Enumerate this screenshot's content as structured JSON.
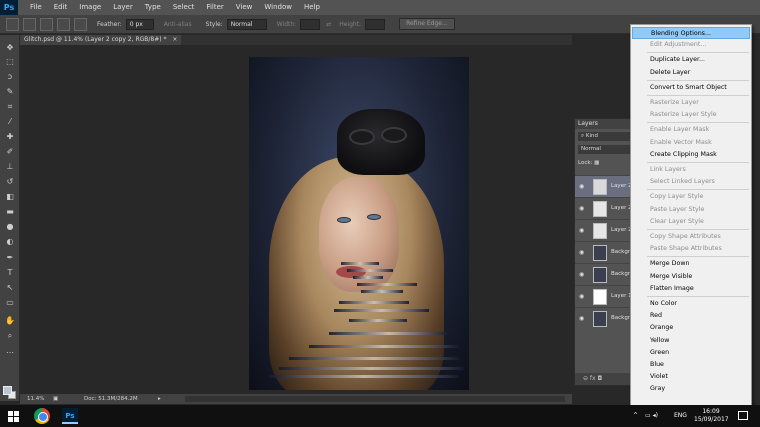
{
  "app": {
    "logo": "Ps"
  },
  "menubar": [
    "File",
    "Edit",
    "Image",
    "Layer",
    "Type",
    "Select",
    "Filter",
    "View",
    "Window",
    "Help"
  ],
  "options_bar": {
    "feather_label": "Feather:",
    "feather_value": "0 px",
    "antialias_label": "Anti-alias",
    "style_label": "Style:",
    "style_value": "Normal",
    "width_label": "Width:",
    "height_label": "Height:",
    "refine_edge": "Refine Edge..."
  },
  "document": {
    "tab_title": "Glitch.psd @ 11.4% (Layer 2 copy 2, RGB/8#) *",
    "tab_close": "×"
  },
  "status": {
    "zoom": "11.4%",
    "doc_info": "Doc: 51.3M/284.2M"
  },
  "layers_panel": {
    "tab": "Layers",
    "kind_filter": "Kind",
    "blend_mode": "Normal",
    "lock_label": "Lock:",
    "footer_icons": "⊖  fx  ◘",
    "layers": [
      {
        "name": "Layer 2 ...",
        "selected": true,
        "thumb": "#d9d9d9"
      },
      {
        "name": "Layer 2 ...",
        "selected": false,
        "thumb": "#e6e6e6"
      },
      {
        "name": "Layer 2 ...",
        "selected": false,
        "thumb": "#e6e6e6"
      },
      {
        "name": "Backgro...",
        "selected": false,
        "thumb": "#3a3f50"
      },
      {
        "name": "Backgro...",
        "selected": false,
        "thumb": "#3a3f50"
      },
      {
        "name": "Layer 1",
        "selected": false,
        "thumb": "#ffffff"
      },
      {
        "name": "Backgro...",
        "selected": false,
        "thumb": "#3a3f50"
      }
    ]
  },
  "context_menu": {
    "items": [
      {
        "label": "Blending Options...",
        "state": "hover"
      },
      {
        "label": "Edit Adjustment...",
        "state": "disabled"
      },
      {
        "sep": true
      },
      {
        "label": "Duplicate Layer...",
        "state": "enabled"
      },
      {
        "label": "Delete Layer",
        "state": "enabled"
      },
      {
        "sep": true
      },
      {
        "label": "Convert to Smart Object",
        "state": "enabled"
      },
      {
        "sep": true
      },
      {
        "label": "Rasterize Layer",
        "state": "disabled"
      },
      {
        "label": "Rasterize Layer Style",
        "state": "disabled"
      },
      {
        "sep": true
      },
      {
        "label": "Enable Layer Mask",
        "state": "disabled"
      },
      {
        "label": "Enable Vector Mask",
        "state": "disabled"
      },
      {
        "label": "Create Clipping Mask",
        "state": "enabled"
      },
      {
        "sep": true
      },
      {
        "label": "Link Layers",
        "state": "disabled"
      },
      {
        "label": "Select Linked Layers",
        "state": "disabled"
      },
      {
        "sep": true
      },
      {
        "label": "Copy Layer Style",
        "state": "disabled"
      },
      {
        "label": "Paste Layer Style",
        "state": "disabled"
      },
      {
        "label": "Clear Layer Style",
        "state": "disabled"
      },
      {
        "sep": true
      },
      {
        "label": "Copy Shape Attributes",
        "state": "disabled"
      },
      {
        "label": "Paste Shape Attributes",
        "state": "disabled"
      },
      {
        "sep": true
      },
      {
        "label": "Merge Down",
        "state": "enabled"
      },
      {
        "label": "Merge Visible",
        "state": "enabled"
      },
      {
        "label": "Flatten Image",
        "state": "enabled"
      },
      {
        "sep": true
      },
      {
        "label": "No Color",
        "state": "enabled"
      },
      {
        "label": "Red",
        "state": "enabled"
      },
      {
        "label": "Orange",
        "state": "enabled"
      },
      {
        "label": "Yellow",
        "state": "enabled"
      },
      {
        "label": "Green",
        "state": "enabled"
      },
      {
        "label": "Blue",
        "state": "enabled"
      },
      {
        "label": "Violet",
        "state": "enabled"
      },
      {
        "label": "Gray",
        "state": "enabled"
      }
    ]
  },
  "taskbar": {
    "tray_arrow": "^",
    "tray_icons": "▭ ◂) ",
    "language": "ENG",
    "time": "16:09",
    "date": "15/09/2017"
  },
  "colors": {
    "hover": "#91c9f7",
    "selected_layer": "#6a6f80"
  }
}
